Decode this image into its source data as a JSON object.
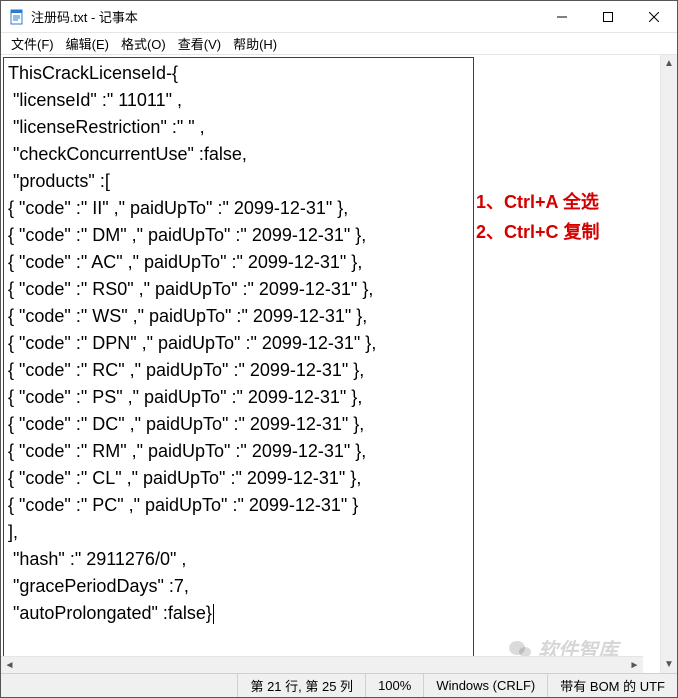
{
  "window": {
    "title": "注册码.txt - 记事本"
  },
  "menu": {
    "file": "文件(F)",
    "edit": "编辑(E)",
    "format": "格式(O)",
    "view": "查看(V)",
    "help": "帮助(H)"
  },
  "editor_text": "ThisCrackLicenseId-{\n \"licenseId\" :\" 11011\" ,\n \"licenseRestriction\" :\" \" ,\n \"checkConcurrentUse\" :false,\n \"products\" :[\n{ \"code\" :\" II\" ,\" paidUpTo\" :\" 2099-12-31\" },\n{ \"code\" :\" DM\" ,\" paidUpTo\" :\" 2099-12-31\" },\n{ \"code\" :\" AC\" ,\" paidUpTo\" :\" 2099-12-31\" },\n{ \"code\" :\" RS0\" ,\" paidUpTo\" :\" 2099-12-31\" },\n{ \"code\" :\" WS\" ,\" paidUpTo\" :\" 2099-12-31\" },\n{ \"code\" :\" DPN\" ,\" paidUpTo\" :\" 2099-12-31\" },\n{ \"code\" :\" RC\" ,\" paidUpTo\" :\" 2099-12-31\" },\n{ \"code\" :\" PS\" ,\" paidUpTo\" :\" 2099-12-31\" },\n{ \"code\" :\" DC\" ,\" paidUpTo\" :\" 2099-12-31\" },\n{ \"code\" :\" RM\" ,\" paidUpTo\" :\" 2099-12-31\" },\n{ \"code\" :\" CL\" ,\" paidUpTo\" :\" 2099-12-31\" },\n{ \"code\" :\" PC\" ,\" paidUpTo\" :\" 2099-12-31\" }\n],\n \"hash\" :\" 2911276/0\" ,\n \"gracePeriodDays\" :7,\n \"autoProlongated\" :false}",
  "annotations": {
    "line1": "1、Ctrl+A 全选",
    "line2": "2、Ctrl+C 复制"
  },
  "watermark": "软件智库",
  "status": {
    "pos": "第 21 行, 第 25 列",
    "zoom": "100%",
    "eol": "Windows (CRLF)",
    "encoding": "带有 BOM 的 UTF"
  }
}
